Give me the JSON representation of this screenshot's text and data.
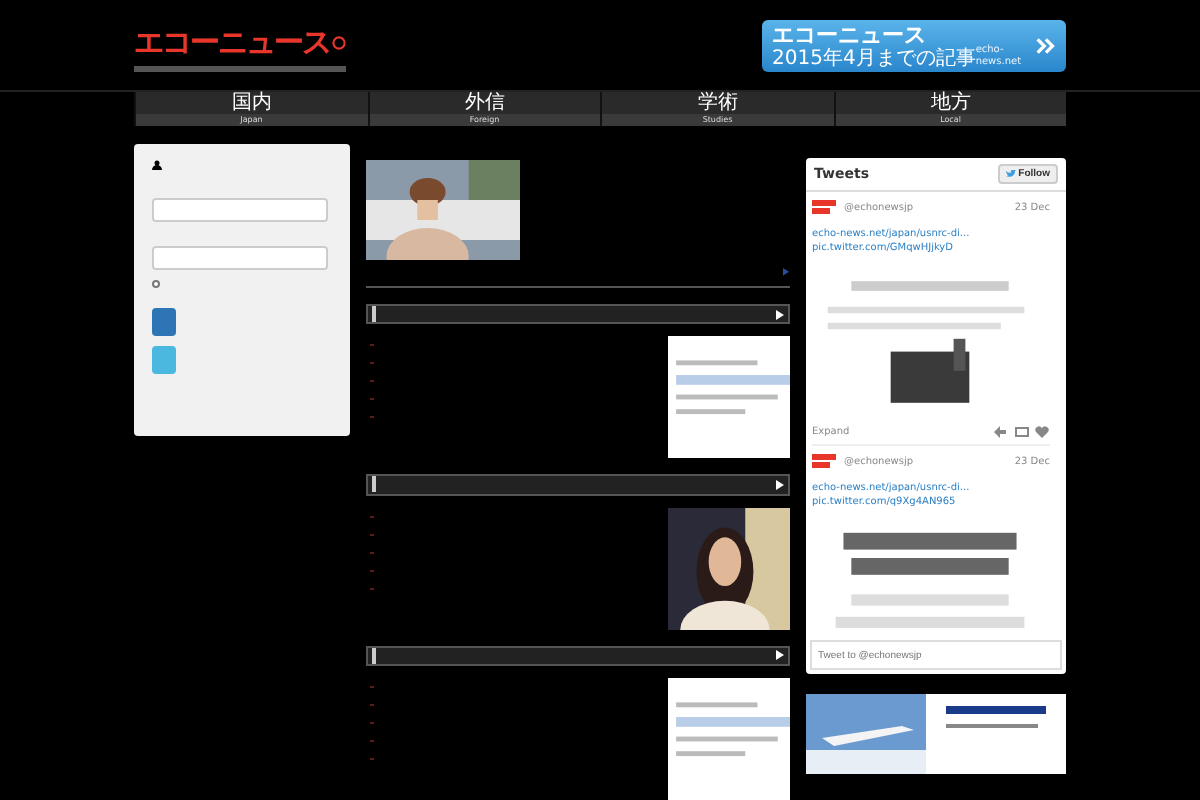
{
  "header": {
    "logo": "エコーニュース",
    "banner": {
      "title": "エコーニュース",
      "subtitle": "2015年4月までの記事",
      "url": "echo-news.net"
    }
  },
  "nav": [
    {
      "label": "国内",
      "sublabel": "Japan"
    },
    {
      "label": "外信",
      "sublabel": "Foreign"
    },
    {
      "label": "学術",
      "sublabel": "Studies"
    },
    {
      "label": "地方",
      "sublabel": "Local"
    }
  ],
  "login": {
    "remember_checked": false
  },
  "tweets": {
    "title": "Tweets",
    "follow": "Follow",
    "compose_placeholder": "Tweet to @echonewsjp",
    "items": [
      {
        "handle": "@echonewsjp",
        "date": "23 Dec",
        "link": "echo-news.net/japan/usnrc-di...",
        "pic": "pic.twitter.com/GMqwHJjkyD",
        "expand": "Expand"
      },
      {
        "handle": "@echonewsjp",
        "date": "23 Dec",
        "link": "echo-news.net/japan/usnrc-di...",
        "pic": "pic.twitter.com/q9Xg4AN965"
      }
    ]
  }
}
